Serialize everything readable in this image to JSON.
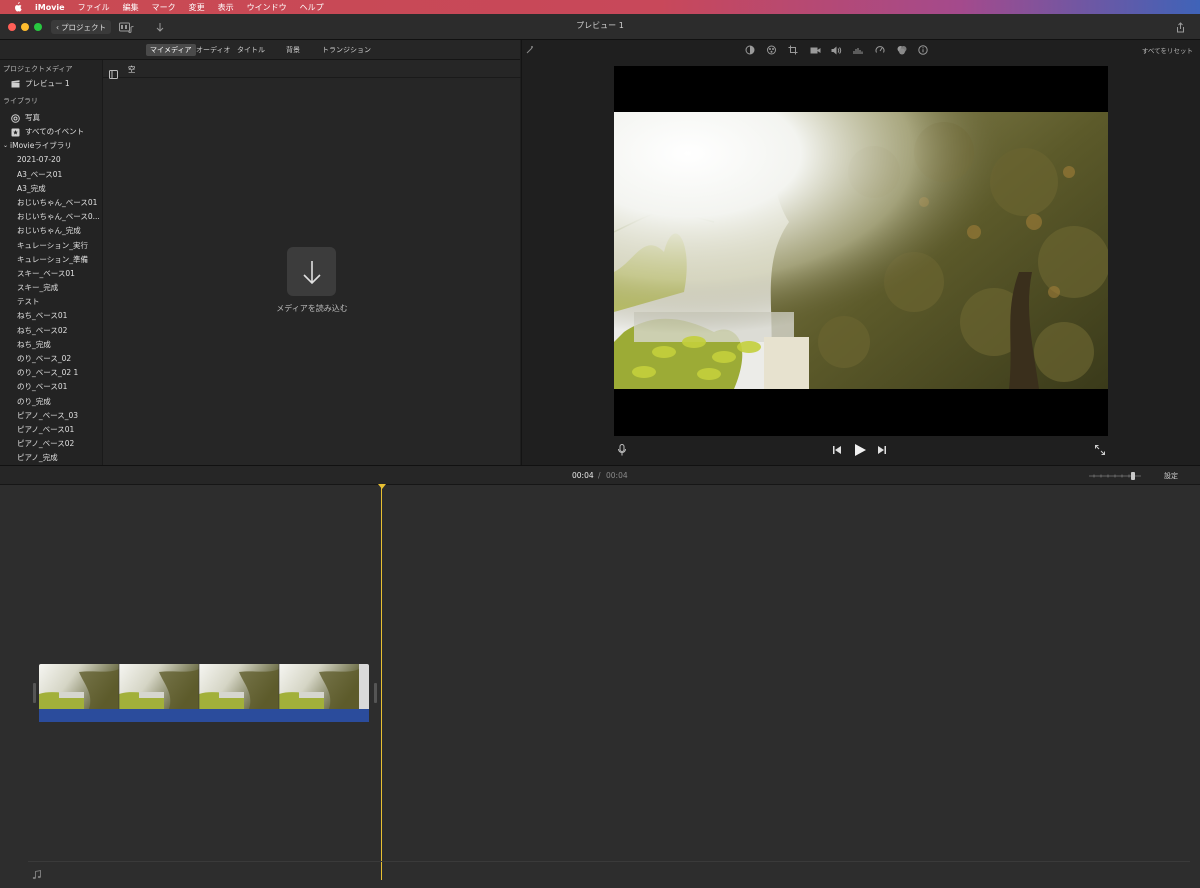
{
  "menubar": {
    "app": "iMovie",
    "items": [
      "ファイル",
      "編集",
      "マーク",
      "変更",
      "表示",
      "ウインドウ",
      "ヘルプ"
    ]
  },
  "titlebar": {
    "back_label": "プロジェクト",
    "title": "プレビュー 1"
  },
  "browser": {
    "tabs": [
      "マイメディア",
      "オーディオ",
      "タイトル",
      "背景",
      "トランジション"
    ],
    "active_tab": "マイメディア",
    "event_name": "空",
    "import_label": "メディアを読み込む"
  },
  "library": {
    "project_media_header": "プロジェクトメディア",
    "project_item": "プレビュー 1",
    "libraries_header": "ライブラリ",
    "photos": "写真",
    "all_events": "すべてのイベント",
    "library_name": "iMovieライブラリ",
    "events": [
      "2021-07-20",
      "A3_ベース01",
      "A3_完成",
      "おじいちゃん_ベース01",
      "おじいちゃん_ベース0...",
      "おじいちゃん_完成",
      "キュレーション_実行",
      "キュレーション_準備",
      "スキー_ベース01",
      "スキー_完成",
      "テスト",
      "ねち_ベース01",
      "ねち_ベース02",
      "ねち_完成",
      "のり_ベース_02",
      "のり_ベース_02 1",
      "のり_ベース01",
      "のり_完成",
      "ピアノ_ベース_03",
      "ピアノ_ベース01",
      "ピアノ_ベース02",
      "ピアノ_完成"
    ]
  },
  "viewer": {
    "reset_all": "すべてをリセット"
  },
  "timeline": {
    "current_time": "00:04",
    "separator": "/",
    "total_time": "00:04",
    "settings": "設定"
  },
  "colors": {
    "playhead": "#e8c032",
    "audio_strip": "#2b4c9c"
  }
}
